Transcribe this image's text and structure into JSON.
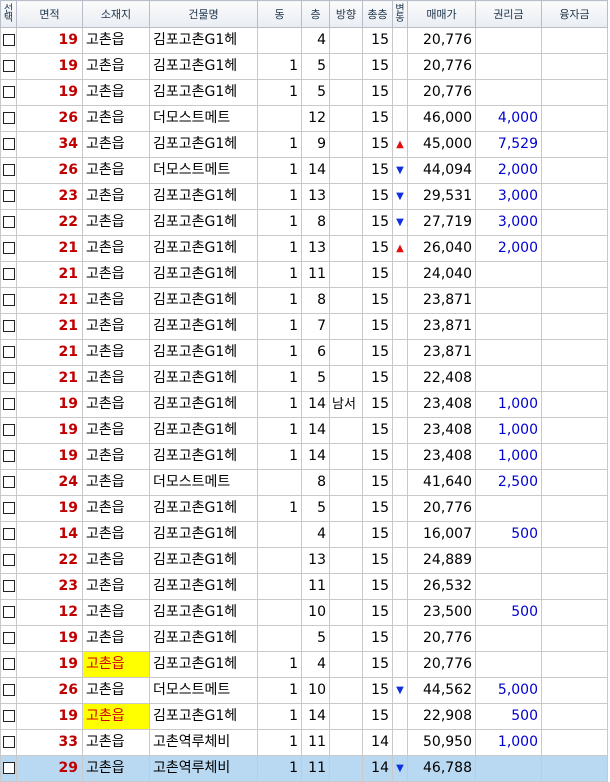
{
  "headers": {
    "select": "선택",
    "area": "면적",
    "location": "소재지",
    "building": "건물명",
    "dong": "동",
    "floor": "층",
    "direction": "방향",
    "total_floors": "총층",
    "change": "변동",
    "sale_price": "매매가",
    "premium": "권리금",
    "loan": "융자금"
  },
  "icons": {
    "up": "▲",
    "down": "▼"
  },
  "colors": {
    "area_text": "#c00000",
    "premium_text": "#0000d0",
    "highlight_bg": "#ffff00",
    "selected_row_bg": "#b9d9f2"
  },
  "rows": [
    {
      "area": "19",
      "location": "고촌읍",
      "building": "김포고촌G1헤",
      "dong": "",
      "floor": "4",
      "direction": "",
      "total": "15",
      "change": "",
      "price": "20,776",
      "premium": "",
      "loan": "",
      "hl": false
    },
    {
      "area": "19",
      "location": "고촌읍",
      "building": "김포고촌G1헤",
      "dong": "1",
      "floor": "5",
      "direction": "",
      "total": "15",
      "change": "",
      "price": "20,776",
      "premium": "",
      "loan": "",
      "hl": false
    },
    {
      "area": "19",
      "location": "고촌읍",
      "building": "김포고촌G1헤",
      "dong": "1",
      "floor": "5",
      "direction": "",
      "total": "15",
      "change": "",
      "price": "20,776",
      "premium": "",
      "loan": "",
      "hl": false
    },
    {
      "area": "26",
      "location": "고촌읍",
      "building": "더모스트메트",
      "dong": "",
      "floor": "12",
      "direction": "",
      "total": "15",
      "change": "",
      "price": "46,000",
      "premium": "4,000",
      "loan": "",
      "hl": false
    },
    {
      "area": "34",
      "location": "고촌읍",
      "building": "김포고촌G1헤",
      "dong": "1",
      "floor": "9",
      "direction": "",
      "total": "15",
      "change": "up",
      "price": "45,000",
      "premium": "7,529",
      "loan": "",
      "hl": false
    },
    {
      "area": "26",
      "location": "고촌읍",
      "building": "더모스트메트",
      "dong": "1",
      "floor": "14",
      "direction": "",
      "total": "15",
      "change": "down",
      "price": "44,094",
      "premium": "2,000",
      "loan": "",
      "hl": false
    },
    {
      "area": "23",
      "location": "고촌읍",
      "building": "김포고촌G1헤",
      "dong": "1",
      "floor": "13",
      "direction": "",
      "total": "15",
      "change": "down",
      "price": "29,531",
      "premium": "3,000",
      "loan": "",
      "hl": false
    },
    {
      "area": "22",
      "location": "고촌읍",
      "building": "김포고촌G1헤",
      "dong": "1",
      "floor": "8",
      "direction": "",
      "total": "15",
      "change": "down",
      "price": "27,719",
      "premium": "3,000",
      "loan": "",
      "hl": false
    },
    {
      "area": "21",
      "location": "고촌읍",
      "building": "김포고촌G1헤",
      "dong": "1",
      "floor": "13",
      "direction": "",
      "total": "15",
      "change": "up",
      "price": "26,040",
      "premium": "2,000",
      "loan": "",
      "hl": false
    },
    {
      "area": "21",
      "location": "고촌읍",
      "building": "김포고촌G1헤",
      "dong": "1",
      "floor": "11",
      "direction": "",
      "total": "15",
      "change": "",
      "price": "24,040",
      "premium": "",
      "loan": "",
      "hl": false
    },
    {
      "area": "21",
      "location": "고촌읍",
      "building": "김포고촌G1헤",
      "dong": "1",
      "floor": "8",
      "direction": "",
      "total": "15",
      "change": "",
      "price": "23,871",
      "premium": "",
      "loan": "",
      "hl": false
    },
    {
      "area": "21",
      "location": "고촌읍",
      "building": "김포고촌G1헤",
      "dong": "1",
      "floor": "7",
      "direction": "",
      "total": "15",
      "change": "",
      "price": "23,871",
      "premium": "",
      "loan": "",
      "hl": false
    },
    {
      "area": "21",
      "location": "고촌읍",
      "building": "김포고촌G1헤",
      "dong": "1",
      "floor": "6",
      "direction": "",
      "total": "15",
      "change": "",
      "price": "23,871",
      "premium": "",
      "loan": "",
      "hl": false
    },
    {
      "area": "21",
      "location": "고촌읍",
      "building": "김포고촌G1헤",
      "dong": "1",
      "floor": "5",
      "direction": "",
      "total": "15",
      "change": "",
      "price": "22,408",
      "premium": "",
      "loan": "",
      "hl": false
    },
    {
      "area": "19",
      "location": "고촌읍",
      "building": "김포고촌G1헤",
      "dong": "1",
      "floor": "14",
      "direction": "남서",
      "total": "15",
      "change": "",
      "price": "23,408",
      "premium": "1,000",
      "loan": "",
      "hl": false
    },
    {
      "area": "19",
      "location": "고촌읍",
      "building": "김포고촌G1헤",
      "dong": "1",
      "floor": "14",
      "direction": "",
      "total": "15",
      "change": "",
      "price": "23,408",
      "premium": "1,000",
      "loan": "",
      "hl": false
    },
    {
      "area": "19",
      "location": "고촌읍",
      "building": "김포고촌G1헤",
      "dong": "1",
      "floor": "14",
      "direction": "",
      "total": "15",
      "change": "",
      "price": "23,408",
      "premium": "1,000",
      "loan": "",
      "hl": false
    },
    {
      "area": "24",
      "location": "고촌읍",
      "building": "더모스트메트",
      "dong": "",
      "floor": "8",
      "direction": "",
      "total": "15",
      "change": "",
      "price": "41,640",
      "premium": "2,500",
      "loan": "",
      "hl": false
    },
    {
      "area": "19",
      "location": "고촌읍",
      "building": "김포고촌G1헤",
      "dong": "1",
      "floor": "5",
      "direction": "",
      "total": "15",
      "change": "",
      "price": "20,776",
      "premium": "",
      "loan": "",
      "hl": false
    },
    {
      "area": "14",
      "location": "고촌읍",
      "building": "김포고촌G1헤",
      "dong": "",
      "floor": "4",
      "direction": "",
      "total": "15",
      "change": "",
      "price": "16,007",
      "premium": "500",
      "loan": "",
      "hl": false
    },
    {
      "area": "22",
      "location": "고촌읍",
      "building": "김포고촌G1헤",
      "dong": "",
      "floor": "13",
      "direction": "",
      "total": "15",
      "change": "",
      "price": "24,889",
      "premium": "",
      "loan": "",
      "hl": false
    },
    {
      "area": "23",
      "location": "고촌읍",
      "building": "김포고촌G1헤",
      "dong": "",
      "floor": "11",
      "direction": "",
      "total": "15",
      "change": "",
      "price": "26,532",
      "premium": "",
      "loan": "",
      "hl": false
    },
    {
      "area": "12",
      "location": "고촌읍",
      "building": "김포고촌G1헤",
      "dong": "",
      "floor": "10",
      "direction": "",
      "total": "15",
      "change": "",
      "price": "23,500",
      "premium": "500",
      "loan": "",
      "hl": false
    },
    {
      "area": "19",
      "location": "고촌읍",
      "building": "김포고촌G1헤",
      "dong": "",
      "floor": "5",
      "direction": "",
      "total": "15",
      "change": "",
      "price": "20,776",
      "premium": "",
      "loan": "",
      "hl": false
    },
    {
      "area": "19",
      "location": "고촌읍",
      "building": "김포고촌G1헤",
      "dong": "1",
      "floor": "4",
      "direction": "",
      "total": "15",
      "change": "",
      "price": "20,776",
      "premium": "",
      "loan": "",
      "hl": true
    },
    {
      "area": "26",
      "location": "고촌읍",
      "building": "더모스트메트",
      "dong": "1",
      "floor": "10",
      "direction": "",
      "total": "15",
      "change": "down",
      "price": "44,562",
      "premium": "5,000",
      "loan": "",
      "hl": false
    },
    {
      "area": "19",
      "location": "고촌읍",
      "building": "김포고촌G1헤",
      "dong": "1",
      "floor": "14",
      "direction": "",
      "total": "15",
      "change": "",
      "price": "22,908",
      "premium": "500",
      "loan": "",
      "hl": true
    },
    {
      "area": "33",
      "location": "고촌읍",
      "building": "고촌역루체비",
      "dong": "1",
      "floor": "11",
      "direction": "",
      "total": "14",
      "change": "",
      "price": "50,950",
      "premium": "1,000",
      "loan": "",
      "hl": false
    },
    {
      "area": "29",
      "location": "고촌읍",
      "building": "고촌역루체비",
      "dong": "1",
      "floor": "11",
      "direction": "",
      "total": "14",
      "change": "down",
      "price": "46,788",
      "premium": "",
      "loan": "",
      "hl": false,
      "selected": true
    }
  ]
}
